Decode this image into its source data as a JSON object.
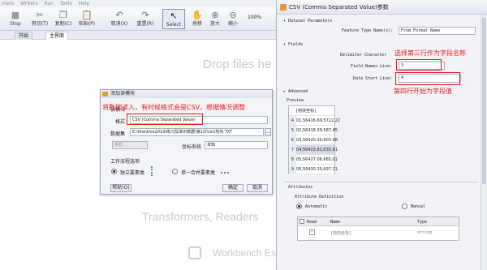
{
  "menubar": {
    "items": [
      "mers",
      "Writers",
      "Run",
      "Tools",
      "Help"
    ]
  },
  "toolbar": {
    "buttons": [
      {
        "label": "Stop",
        "icon": "stop-icon"
      },
      {
        "label": "剪切(T)",
        "icon": "scissors-icon"
      },
      {
        "label": "复制(C)",
        "icon": "copy-icon"
      },
      {
        "label": "粘贴(P)",
        "icon": "paste-icon"
      },
      {
        "label": "取消(X)",
        "icon": "undo-icon"
      },
      {
        "label": "重置(R)",
        "icon": "redo-icon"
      },
      {
        "label": "Select",
        "icon": "cursor-icon"
      },
      {
        "label": "拖移",
        "icon": "hand-icon"
      },
      {
        "label": "放大",
        "icon": "zoom-in-icon"
      },
      {
        "label": "缩小",
        "icon": "zoom-out-icon"
      }
    ],
    "zoom": "100%"
  },
  "tabs": [
    "开始",
    "主界面"
  ],
  "canvas": {
    "drop_hint": "Drop files he",
    "transformers_hint": "Transformers, Readers",
    "workbench_hint": "Workbench Ess"
  },
  "dialog": {
    "title": "添加读模块",
    "annotation": "将数据读入，有时候格式会是CSV，根据情况调整",
    "reader_label": "读模块",
    "format_label": "格式",
    "format_value": "CSV (Comma Separated Value)",
    "dataset_label": "数据集",
    "dataset_value": "E:\\fme\\fme2019\\练习及演示数据\\第1次\\txt\\地块.TXT",
    "params_button": "参数...",
    "coord_label": "坐标系统",
    "coord_value": "未知",
    "workflow_label": "工作流程选项",
    "option_independent": "独立要素类",
    "option_single": "单一合并要素类",
    "help_button": "帮助(O)",
    "ok_button": "确定",
    "cancel_button": "取消"
  },
  "param": {
    "title": "CSV (Comma Separated Value)参数",
    "dataset_params": "Dataset Parameters",
    "feature_type_label": "Feature Type Name(s):",
    "feature_type_value": "From Format Name",
    "fields_header": "Fields",
    "delimiter_label": "Delimiter Character",
    "field_names_label": "Field Names Line:",
    "field_names_value": "3",
    "data_start_label": "Data Start Line:",
    "data_start_value": "4",
    "annotation_field_names": "选择第三行作为字段名称",
    "annotation_data_start": "第四行开始为字段值",
    "advanced": "Advanced",
    "preview_label": "Preview",
    "preview_header": "[地块坐标]",
    "preview_rows": [
      {
        "n": "4",
        "v": "01,56416.69,5722.22"
      },
      {
        "n": "5",
        "v": "02,56418.39,587.45"
      },
      {
        "n": "6",
        "v": "03,56420.20,603.58"
      },
      {
        "n": "7",
        "v": "04,56423.81,635.91"
      },
      {
        "n": "8",
        "v": "05,56427.06,665.01"
      },
      {
        "n": "9",
        "v": "06,56430.20,697.11"
      }
    ],
    "attributes_label": "Attributes",
    "attr_def_label": "Attribute Definition",
    "automatic": "Automatic",
    "manual": "Manual",
    "col_read": "Read",
    "col_name": "Name",
    "col_type": "Type",
    "row_name": "[地块坐标]",
    "row_type": "string"
  }
}
